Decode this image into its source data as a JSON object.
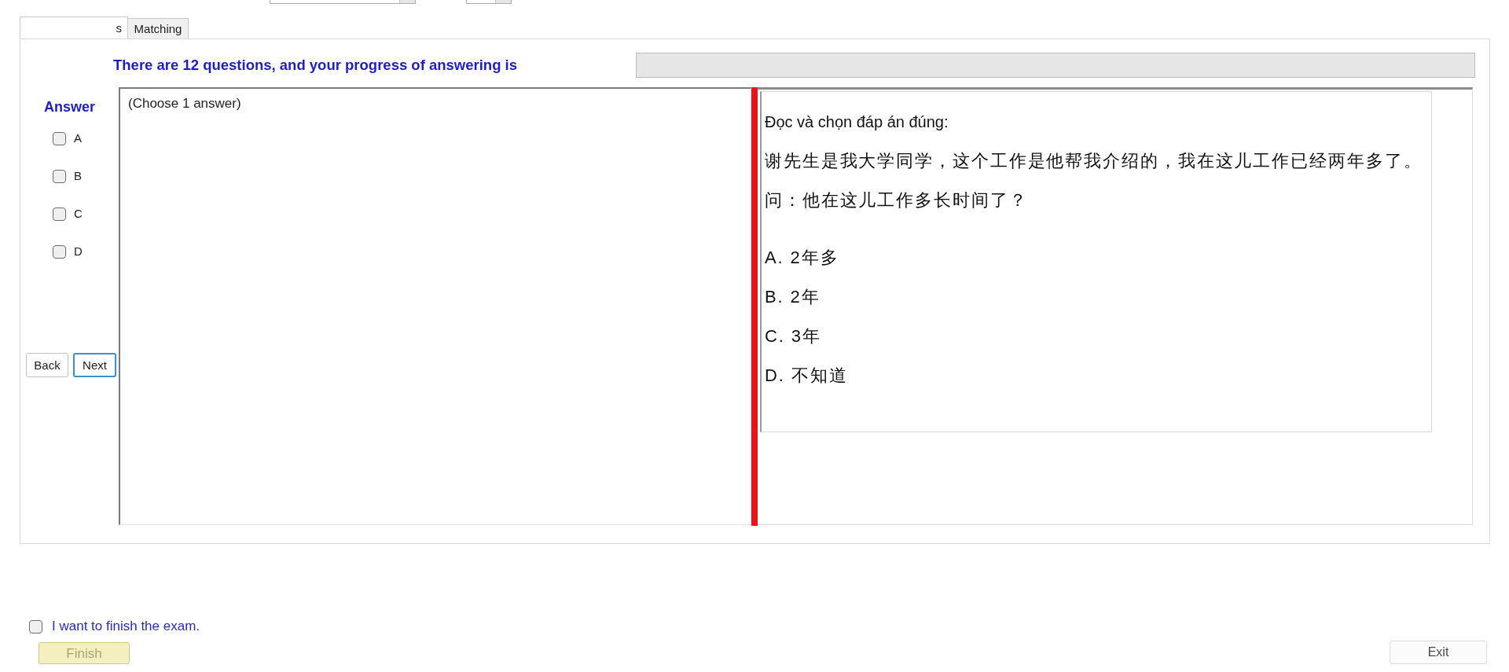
{
  "top_fields": [
    {
      "kind": "dropdown"
    },
    {
      "kind": "dropdown"
    }
  ],
  "tabs": [
    {
      "label": "s",
      "selected": true
    },
    {
      "label": "Matching",
      "selected": false
    }
  ],
  "progress": {
    "label": "There are 12 questions, and your progress of answering is",
    "level": 0
  },
  "answer_panel": {
    "title": "Answer",
    "options": [
      {
        "label": "A",
        "checked": false
      },
      {
        "label": "B",
        "checked": false
      },
      {
        "label": "C",
        "checked": false
      },
      {
        "label": "D",
        "checked": false
      }
    ],
    "buttons": [
      {
        "label": "Back",
        "focused": false
      },
      {
        "label": "Next",
        "focused": true
      }
    ]
  },
  "answer_box": {
    "text": "(Choose 1 answer)"
  },
  "question": {
    "instruction": "Đọc và chọn đáp án đúng:",
    "lines": [
      "谢先生是我大学同学，这个工作是他帮我介绍的，我在这儿工作已经两年多了。",
      "问：他在这儿工作多长时间了？"
    ],
    "options": [
      "A. 2年多",
      "B. 2年",
      "C. 3年",
      "D. 不知道"
    ]
  },
  "footer": {
    "finish_confirm": {
      "label": "I want to finish the exam.",
      "checked": false
    },
    "finish_button": {
      "label": "Finish",
      "disabled": true
    },
    "exit_button": {
      "label": "Exit"
    }
  }
}
